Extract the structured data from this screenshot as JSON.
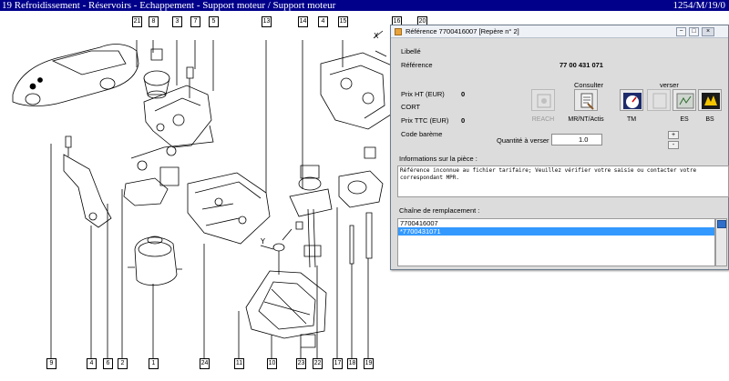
{
  "topbar": {
    "title": "19 Refroidissement - Réservoirs - Echappement - Support moteur / Support moteur",
    "code": "1254/M/19/0"
  },
  "diagram": {
    "callouts": [
      "21",
      "8",
      "3",
      "7",
      "5",
      "13",
      "14",
      "4",
      "15",
      "16",
      "20",
      "9",
      "4",
      "6",
      "2",
      "1",
      "24",
      "11",
      "10",
      "23",
      "22",
      "17",
      "18",
      "19"
    ]
  },
  "dialog": {
    "title": "Référence 7700416007 [Repère n° 2]",
    "window_buttons": {
      "minimize": "−",
      "maximize": "□",
      "close": "×"
    },
    "libelle_label": "Libellé",
    "reference_label": "Référence",
    "reference_value": "77 00 431 071",
    "prix_ht_label": "Prix HT (EUR)",
    "prix_ht_value": "0",
    "cort": "CORT",
    "prix_ttc_label": "Prix TTC (EUR)",
    "prix_ttc_value": "0",
    "code_bareme_label": "Code barème",
    "consulter_label": "Consulter",
    "verser_label": "verser",
    "quantity_label": "Quantité à verser :",
    "quantity_value": "1.0",
    "spin_plus": "+",
    "spin_minus": "-",
    "tools": {
      "reach": "REACH",
      "mr": "MR/NT/Actis",
      "tm": "TM",
      "es": "ES",
      "bs": "BS"
    },
    "info_label": "Informations sur la pièce :",
    "info_text": "Référence inconnue au fichier tarifaire; Veuillez vérifier votre saisie ou contacter votre correspondant MPR.",
    "chain_label": "Chaîne de remplacement :",
    "chain_items": [
      "7700416007",
      "*7700431071"
    ]
  },
  "colors": {
    "titlebar": "#00008b",
    "dialog_bg": "#dcdcdc",
    "selection": "#3399ff",
    "scroll_arrow": "#2f6fc9"
  }
}
